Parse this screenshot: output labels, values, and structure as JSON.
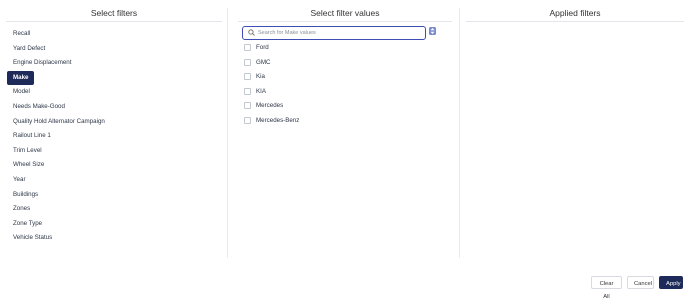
{
  "panels": {
    "select_filters": {
      "title": "Select filters",
      "items": [
        {
          "label": "Recall"
        },
        {
          "label": "Yard Defect"
        },
        {
          "label": "Engine Displacement"
        },
        {
          "label": "Make",
          "active": true
        },
        {
          "label": "Model"
        },
        {
          "label": "Needs Make-Good"
        },
        {
          "label": "Quality Hold Alternator Campaign"
        },
        {
          "label": "Railout Line 1"
        },
        {
          "label": "Trim Level"
        },
        {
          "label": "Wheel Size"
        },
        {
          "label": "Year"
        },
        {
          "label": "Buildings"
        },
        {
          "label": "Zones"
        },
        {
          "label": "Zone Type"
        },
        {
          "label": "Vehicle Status"
        }
      ]
    },
    "select_values": {
      "title": "Select filter values",
      "search_placeholder": "Search for Make values",
      "values": [
        "Ford",
        "GMC",
        "Kia",
        "KIA",
        "Mercedes",
        "Mercedes-Benz"
      ]
    },
    "applied_filters": {
      "title": "Applied filters"
    }
  },
  "footer": {
    "clear_all": "Clear All",
    "cancel": "Cancel",
    "apply": "Apply"
  },
  "colors": {
    "primary": "#1e2a5a",
    "focus_border": "#3d4db3",
    "sort_button": "#7b8bd1"
  }
}
